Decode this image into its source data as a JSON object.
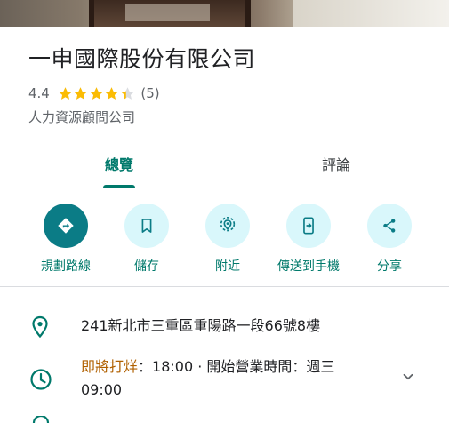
{
  "place": {
    "name": "一申國際股份有限公司",
    "rating": "4.4",
    "rating_value": 4.4,
    "review_count": "(5)",
    "category": "人力資源顧問公司"
  },
  "tabs": [
    {
      "label": "總覽",
      "active": true
    },
    {
      "label": "評論",
      "active": false
    }
  ],
  "actions": [
    {
      "label": "規劃路線",
      "icon": "directions-icon"
    },
    {
      "label": "儲存",
      "icon": "bookmark-icon"
    },
    {
      "label": "附近",
      "icon": "nearby-icon"
    },
    {
      "label": "傳送到手機",
      "icon": "send-to-phone-icon"
    },
    {
      "label": "分享",
      "icon": "share-icon"
    }
  ],
  "info": {
    "address": "241新北市三重區重陽路一段66號8樓",
    "hours_status": "即將打烊",
    "hours_detail": "：18:00 · 開始營業時間：週三",
    "hours_detail_line2": "09:00"
  },
  "colors": {
    "accent": "#00796b",
    "primary_action_bg": "#0b7c86",
    "action_bg": "#d9f7fb",
    "star": "#fbbc04",
    "closing_soon": "#b06000"
  }
}
